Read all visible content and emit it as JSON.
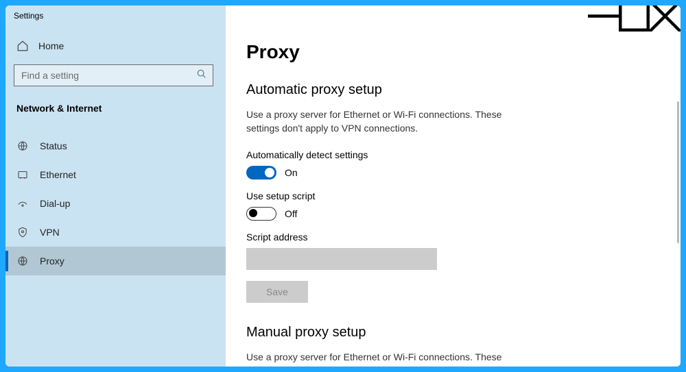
{
  "window": {
    "title": "Settings"
  },
  "sidebar": {
    "home_label": "Home",
    "search_placeholder": "Find a setting",
    "section_title": "Network & Internet",
    "items": [
      {
        "label": "Status"
      },
      {
        "label": "Ethernet"
      },
      {
        "label": "Dial-up"
      },
      {
        "label": "VPN"
      },
      {
        "label": "Proxy"
      }
    ]
  },
  "main": {
    "title": "Proxy",
    "auto": {
      "heading": "Automatic proxy setup",
      "desc": "Use a proxy server for Ethernet or Wi-Fi connections. These settings don't apply to VPN connections.",
      "detect_label": "Automatically detect settings",
      "detect_state": "On",
      "script_label": "Use setup script",
      "script_state": "Off",
      "address_label": "Script address",
      "save_label": "Save"
    },
    "manual": {
      "heading": "Manual proxy setup",
      "desc": "Use a proxy server for Ethernet or Wi-Fi connections. These settings"
    }
  }
}
